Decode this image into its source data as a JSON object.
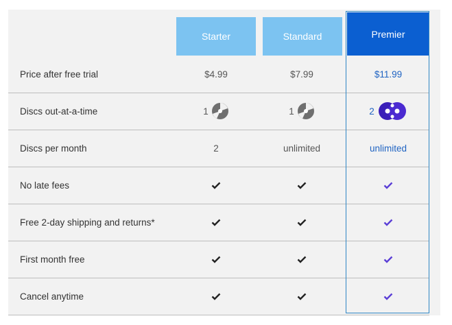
{
  "plans": {
    "starter": "Starter",
    "standard": "Standard",
    "premier": "Premier"
  },
  "rows": {
    "price": {
      "label": "Price after free trial",
      "starter": "$4.99",
      "standard": "$7.99",
      "premier": "$11.99"
    },
    "discs_out": {
      "label": "Disc out-at-a-time",
      "starter": "1",
      "standard": "1",
      "premier": "2"
    },
    "discs_month": {
      "label": "Discs per month",
      "starter": "2",
      "standard": "unlimited",
      "premier": "unlimited"
    },
    "no_late": {
      "label": "No late fees"
    },
    "shipping": {
      "label": "Free 2-day shipping and returns*"
    },
    "first_month": {
      "label": "First month free"
    },
    "cancel": {
      "label": "Cancel anytime"
    }
  },
  "colors": {
    "header_light": "#7cc3f1",
    "header_premier": "#0b5fd1",
    "check_dark": "#222222",
    "check_premier": "#5b3fd6",
    "premier_text": "#1f63c2"
  },
  "icons": {
    "disc": "disc-icon",
    "premier_disc": "double-disc-icon",
    "check": "check-icon"
  }
}
